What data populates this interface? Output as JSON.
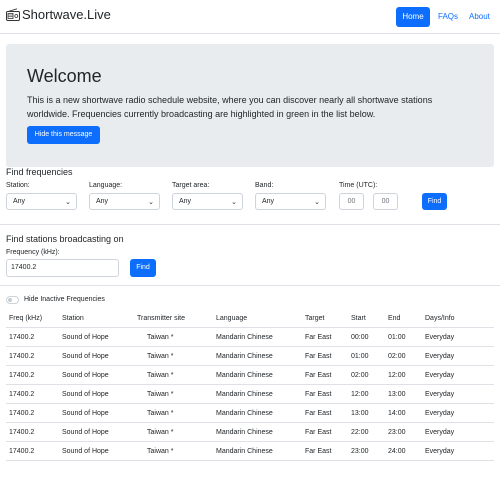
{
  "navbar": {
    "brand": "Shortwave.Live",
    "links": [
      "Home",
      "FAQs",
      "About"
    ]
  },
  "welcome": {
    "title": "Welcome",
    "text": "This is a new shortwave radio schedule website, where you can discover nearly all shortwave stations worldwide. Frequencies currently broadcasting are highlighted in green in the list below.",
    "hide_button": "Hide this message"
  },
  "find_frequencies": {
    "title": "Find frequencies",
    "station_label": "Station:",
    "station_value": "Any",
    "language_label": "Language:",
    "language_value": "Any",
    "target_label": "Target area:",
    "target_value": "Any",
    "band_label": "Band:",
    "band_value": "Any",
    "time_label": "Time (UTC):",
    "time_start_placeholder": "00",
    "time_end_placeholder": "00",
    "find_button": "Find"
  },
  "find_stations": {
    "title": "Find stations broadcasting on",
    "freq_label": "Frequency (kHz):",
    "freq_value": "17400.2",
    "find_button": "Find"
  },
  "toggle": {
    "label": "Hide Inactive Frequencies",
    "on": false
  },
  "table": {
    "headers": [
      "Freq (kHz)",
      "Station",
      "Transmitter site",
      "Language",
      "Target",
      "Start",
      "End",
      "Days/Info"
    ],
    "rows": [
      [
        "17400.2",
        "Sound of Hope",
        "Taiwan *",
        "Mandarin Chinese",
        "Far East",
        "00:00",
        "01:00",
        "Everyday"
      ],
      [
        "17400.2",
        "Sound of Hope",
        "Taiwan *",
        "Mandarin Chinese",
        "Far East",
        "01:00",
        "02:00",
        "Everyday"
      ],
      [
        "17400.2",
        "Sound of Hope",
        "Taiwan *",
        "Mandarin Chinese",
        "Far East",
        "02:00",
        "12:00",
        "Everyday"
      ],
      [
        "17400.2",
        "Sound of Hope",
        "Taiwan *",
        "Mandarin Chinese",
        "Far East",
        "12:00",
        "13:00",
        "Everyday"
      ],
      [
        "17400.2",
        "Sound of Hope",
        "Taiwan *",
        "Mandarin Chinese",
        "Far East",
        "13:00",
        "14:00",
        "Everyday"
      ],
      [
        "17400.2",
        "Sound of Hope",
        "Taiwan *",
        "Mandarin Chinese",
        "Far East",
        "22:00",
        "23:00",
        "Everyday"
      ],
      [
        "17400.2",
        "Sound of Hope",
        "Taiwan *",
        "Mandarin Chinese",
        "Far East",
        "23:00",
        "24:00",
        "Everyday"
      ]
    ]
  },
  "icons": {
    "brand_icon": "radio-icon",
    "select_icon": "chevron-down-icon"
  },
  "colors": {
    "primary": "#0d6efd",
    "jumbotron": "#e9ecef",
    "border": "#dee2e6"
  }
}
